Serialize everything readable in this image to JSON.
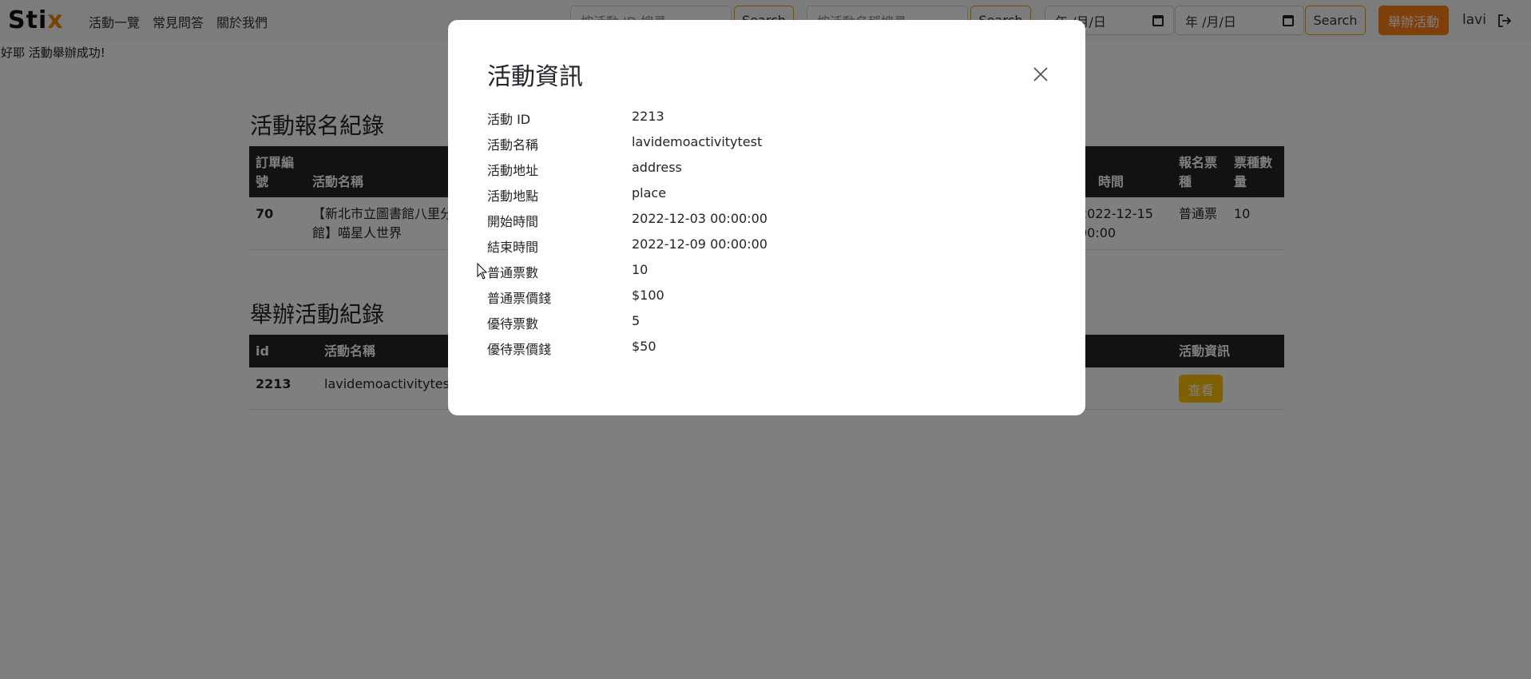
{
  "navbar": {
    "logo_prefix": "St",
    "logo_mid": "i",
    "logo_x": "x",
    "links": [
      "活動一覽",
      "常見問答",
      "關於我們"
    ],
    "search_id_placeholder": "按活動 ID 搜尋",
    "search_name_placeholder": "按活動名稱搜尋",
    "search_label": "Search",
    "date_from": "年 /月/日",
    "date_to": "年 /月/日",
    "host_button": "舉辦活動",
    "username": "lavi"
  },
  "flash_message": "好耶 活動舉辦成功!",
  "registrations": {
    "title": "活動報名紀錄",
    "headers": {
      "order_no": "訂單編號",
      "event_name": "活動名稱",
      "time": "時間",
      "ticket_type": "報名票種",
      "ticket_qty": "票種數量"
    },
    "row": {
      "order_no": "70",
      "event_name": "【新北市立圖書館八里分館】喵星人世界",
      "time": "2022-12-15 00:00",
      "ticket_type": "普通票",
      "ticket_qty": "10"
    }
  },
  "hosted": {
    "title": "舉辦活動紀錄",
    "headers": {
      "id": "id",
      "event_name": "活動名稱",
      "info": "活動資訊"
    },
    "row": {
      "id": "2213",
      "event_name": "lavidemoactivitytest",
      "view_button": "查看"
    }
  },
  "modal": {
    "title": "活動資訊",
    "rows": [
      {
        "label": "活動 ID",
        "value": "2213"
      },
      {
        "label": "活動名稱",
        "value": "lavidemoactivitytest"
      },
      {
        "label": "活動地址",
        "value": "address"
      },
      {
        "label": "活動地點",
        "value": "place"
      },
      {
        "label": "開始時間",
        "value": "2022-12-03 00:00:00"
      },
      {
        "label": "結束時間",
        "value": "2022-12-09 00:00:00"
      },
      {
        "label": "普通票數",
        "value": "10"
      },
      {
        "label": "普通票價錢",
        "value": "$100"
      },
      {
        "label": "優待票數",
        "value": "5"
      },
      {
        "label": "優待票價錢",
        "value": "$50"
      }
    ]
  },
  "colors": {
    "brand_orange": "#fd7e14",
    "logo_orange": "#f08a00",
    "view_button": "#ffc107",
    "table_header": "#212529"
  }
}
